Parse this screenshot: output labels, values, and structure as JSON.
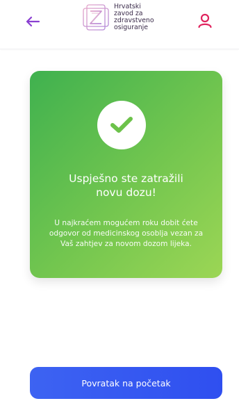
{
  "header": {
    "back_icon": "arrow-left-icon",
    "logo_icon": "hzzo-logo-icon",
    "logo_lines": [
      "Hrvatski",
      "zavod za",
      "zdravstveno",
      "osiguranje"
    ],
    "user_icon": "user-icon",
    "back_icon_color": "#8a3fd1",
    "user_icon_color": "#e0245e"
  },
  "card": {
    "icon": "checkmark-icon",
    "title_lines": [
      "Uspješno ste zatražili",
      "novu dozu!"
    ],
    "text_lines": [
      "U najkraćem mogućem roku dobit ćete",
      "odgovor od medicinskog osoblja vezan za",
      "Vaš zahtjev za novom dozom lijeka."
    ],
    "gradient_start": "#3fb14f",
    "gradient_end": "#9cd655",
    "check_color": "#6cc24a"
  },
  "footer": {
    "button_label": "Povratak na početak",
    "button_color": "#3557f0"
  }
}
